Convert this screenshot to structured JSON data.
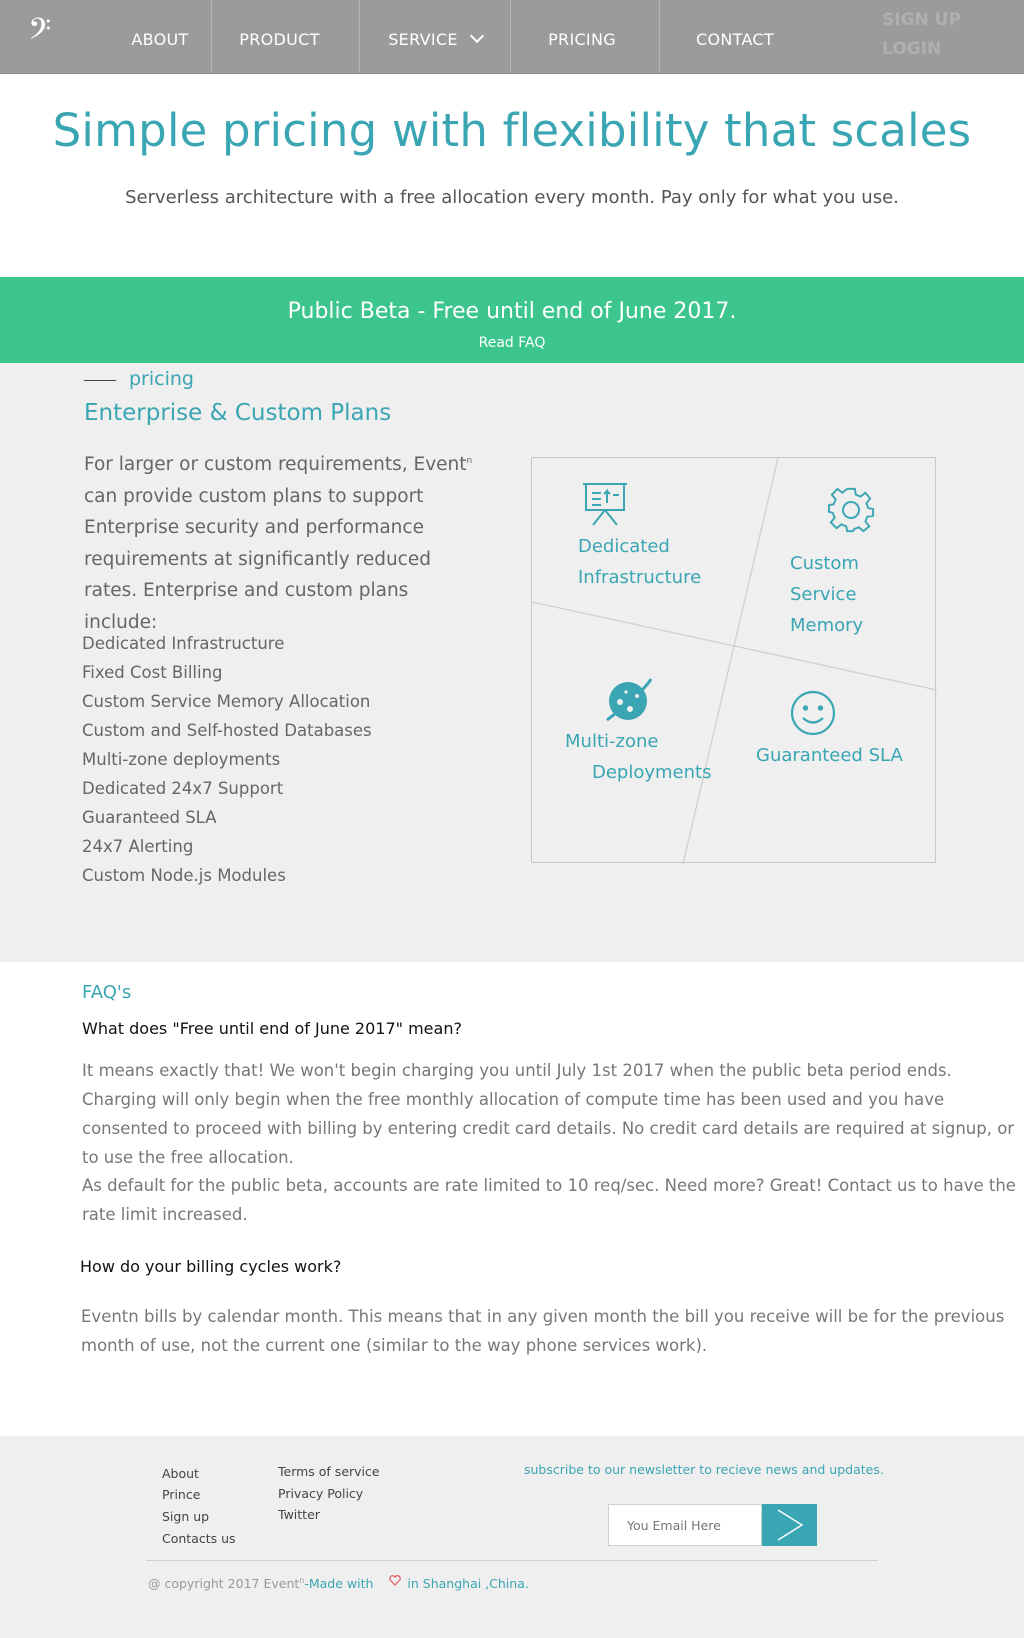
{
  "nav": {
    "logo_icon": "bass-clef-icon",
    "items": [
      {
        "label": "ABOUT"
      },
      {
        "label": "PRODUCT"
      },
      {
        "label": "SERVICE"
      },
      {
        "label": "PRICING"
      },
      {
        "label": "CONTACT"
      }
    ],
    "sign_up": "SIGN UP",
    "login": "LOGIN"
  },
  "hero": {
    "title": "Simple pricing with flexibility that scales",
    "subtitle": "Serverless architecture with a free allocation every month. Pay only for what you use."
  },
  "banner": {
    "title": "Public Beta - Free until end of June 2017.",
    "link": "Read FAQ"
  },
  "pricing": {
    "tag": "pricing",
    "title": "Enterprise & Custom Plans",
    "intro_before": "For larger or custom requirements, Event",
    "intro_sup": "n",
    "intro_after": " can provide custom plans to support Enterprise security and performance requirements at significantly reduced rates. Enterprise and custom plans include:",
    "features": [
      "Dedicated Infrastructure",
      "Fixed Cost Billing",
      "Custom Service Memory Allocation",
      "Custom and Self-hosted Databases",
      "Multi-zone deployments",
      "Dedicated 24x7 Support",
      "Guaranteed SLA",
      "24x7 Alerting",
      "Custom Node.js Modules"
    ],
    "quadrants": {
      "infra": {
        "line1": "Dedicated",
        "line2": "Infrastructure",
        "icon": "presentation-board-icon"
      },
      "memory": {
        "line1": "Custom",
        "line2": "Service Memory",
        "icon": "gear-icon"
      },
      "multizone": {
        "line1": "Multi-zone",
        "line2": "Deployments",
        "icon": "planet-icon"
      },
      "sla": {
        "line1": "Guaranteed SLA",
        "icon": "smiley-icon"
      }
    },
    "accent_color": "#3aa6b3"
  },
  "faq": {
    "tag": "FAQ's",
    "q1": "What does \"Free until end of June 2017\" mean?",
    "a1_p1": "It means exactly that! We won't begin charging you until July 1st 2017 when the public beta period ends. Charging will only begin when the free monthly allocation of compute time has been used and you have consented to proceed with billing by entering credit card details. No credit card details are required at signup, or to use the free allocation.",
    "a1_p2": "As default for the public beta, accounts are rate limited to 10 req/sec. Need more? Great! Contact us to have the rate limit increased.",
    "q2": "How do your billing cycles work?",
    "a2": "Eventn bills by calendar month. This means that in any given month the bill you receive will be for the previous month of use, not the current one (similar to the way phone services work)."
  },
  "footer": {
    "links_col1": [
      "About",
      "Prince",
      "Sign up",
      "Contacts us"
    ],
    "links_col2": [
      "Terms of service",
      "Privacy Policy",
      "Twitter"
    ],
    "subscribe": "subscribe to our newsletter  to recieve news and updates.",
    "email_placeholder": "You Email Here",
    "copyright_prefix": "@ copyright 2017 Event",
    "copyright_sup": "n",
    "made_with": "-Made with",
    "heart_icon": "heart-icon",
    "location": "in Shanghai ,China."
  },
  "colors": {
    "nav_bg": "#9b9b9b",
    "banner_bg": "#3cc68e",
    "accent": "#3aa6b3",
    "section_bg": "#efefef"
  }
}
